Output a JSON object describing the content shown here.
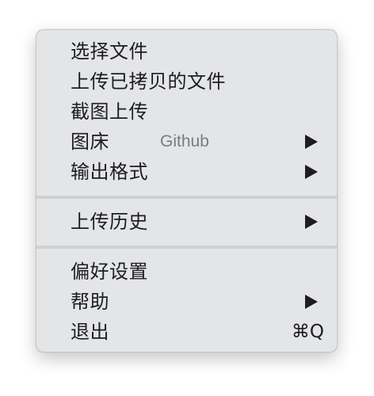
{
  "menu": {
    "items": [
      {
        "label": "选择文件"
      },
      {
        "label": "上传已拷贝的文件"
      },
      {
        "label": "截图上传"
      },
      {
        "label": "图床",
        "value": "Github",
        "submenu_arrow": "triangle-right-icon"
      },
      {
        "label": "输出格式",
        "submenu_arrow": "triangle-right-icon"
      },
      {
        "label": "上传历史",
        "submenu_arrow": "triangle-right-icon"
      },
      {
        "label": "偏好设置"
      },
      {
        "label": "帮助",
        "submenu_arrow": "triangle-right-icon"
      },
      {
        "label": "退出",
        "shortcut": "⌘Q"
      }
    ]
  }
}
